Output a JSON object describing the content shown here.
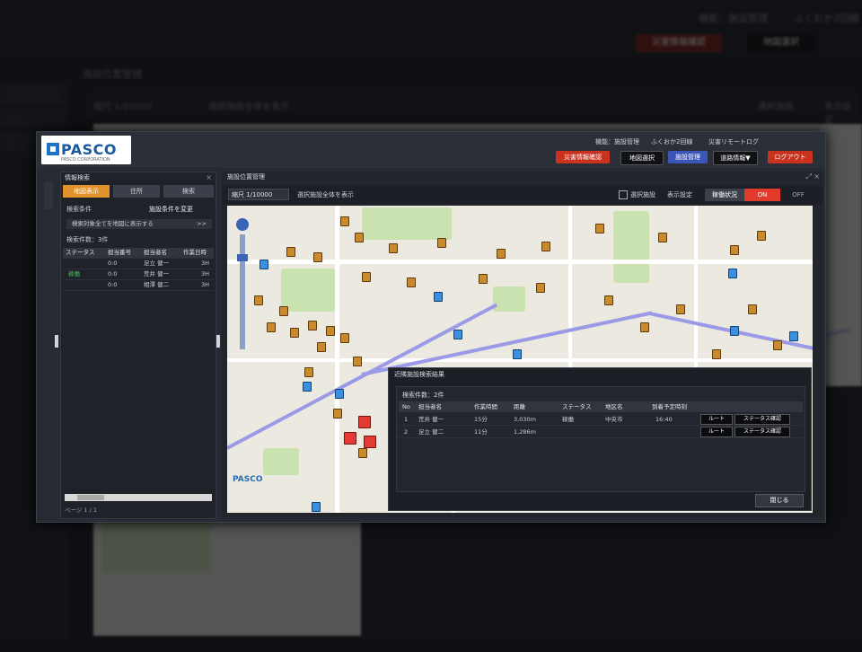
{
  "background": {
    "header_links": [
      "機能：施設管理",
      "ふくおか2回線"
    ],
    "header_buttons": [
      "災害情報確認",
      "地図選択"
    ],
    "page_title": "施設位置管理",
    "toolbar": {
      "scale": "縮尺 1/10000",
      "display_label": "選択施設全体を表示",
      "checkbox_label": "選択施設",
      "right_label": "表示設定"
    }
  },
  "modal": {
    "logo": {
      "text": "PASCO",
      "sub": "PASCO CORPORATION"
    },
    "header_links": [
      "機能：施設管理",
      "ふくおか2回線",
      "災害リモートログ"
    ],
    "header_buttons": [
      {
        "label": "災害情報確認",
        "color": "#c8321f"
      },
      {
        "label": "地図選択",
        "color": "#0f1115"
      },
      {
        "label": "施設管理",
        "color": "#3b55b8"
      },
      {
        "label": "道路情報▼",
        "color": "#0f1115"
      },
      {
        "label": "ログアウト",
        "color": "#c8321f"
      }
    ],
    "left_panel": {
      "title": "情報検索",
      "tabs": [
        "地図表示",
        "住所",
        "検索"
      ],
      "search_target_label": "検索条件",
      "search_target_value": "施設条件を変更",
      "box_text": "検索対象全てを地図に表示する",
      "box_chevron": ">>",
      "result_count": "検索件数：3件",
      "columns": [
        "ステータス",
        "担当番号",
        "担当者名",
        "作業日時"
      ],
      "rows": [
        [
          "",
          "0:0",
          "足立 健一",
          "3H"
        ],
        [
          "稼働",
          "0:0",
          "荒井 健一",
          "3H"
        ],
        [
          "",
          "0:0",
          "相澤 健二",
          "3H"
        ]
      ],
      "footer": "ページ 1 / 1"
    },
    "map_panel": {
      "title": "施設位置管理",
      "scale": "縮尺 1/10000",
      "display_all": "選択施設全体を表示",
      "checkbox_label": "選択施設",
      "settings_label": "表示設定",
      "toggle_label": "稼働状況",
      "toggle_on": "ON",
      "toggle_off": "OFF",
      "map_logo": "PASCO"
    },
    "result_dialog": {
      "title": "近隣施設検索結果",
      "count": "検索件数：2件",
      "columns": [
        "No",
        "担当者名",
        "作業時間",
        "距離",
        "ステータス",
        "地区名",
        "到着予定時刻"
      ],
      "rows": [
        {
          "no": "1",
          "name": "荒井 健一",
          "time": "15分",
          "distance": "3,030m",
          "status": "稼働",
          "area": "中央市",
          "eta": "16:40",
          "route": "ルート",
          "detail": "ステータス確認"
        },
        {
          "no": "2",
          "name": "足立 健二",
          "time": "11分",
          "distance": "1,286m",
          "status": "",
          "area": "",
          "eta": "",
          "route": "ルート",
          "detail": "ステータス確認"
        }
      ],
      "close_label": "閉じる"
    }
  }
}
